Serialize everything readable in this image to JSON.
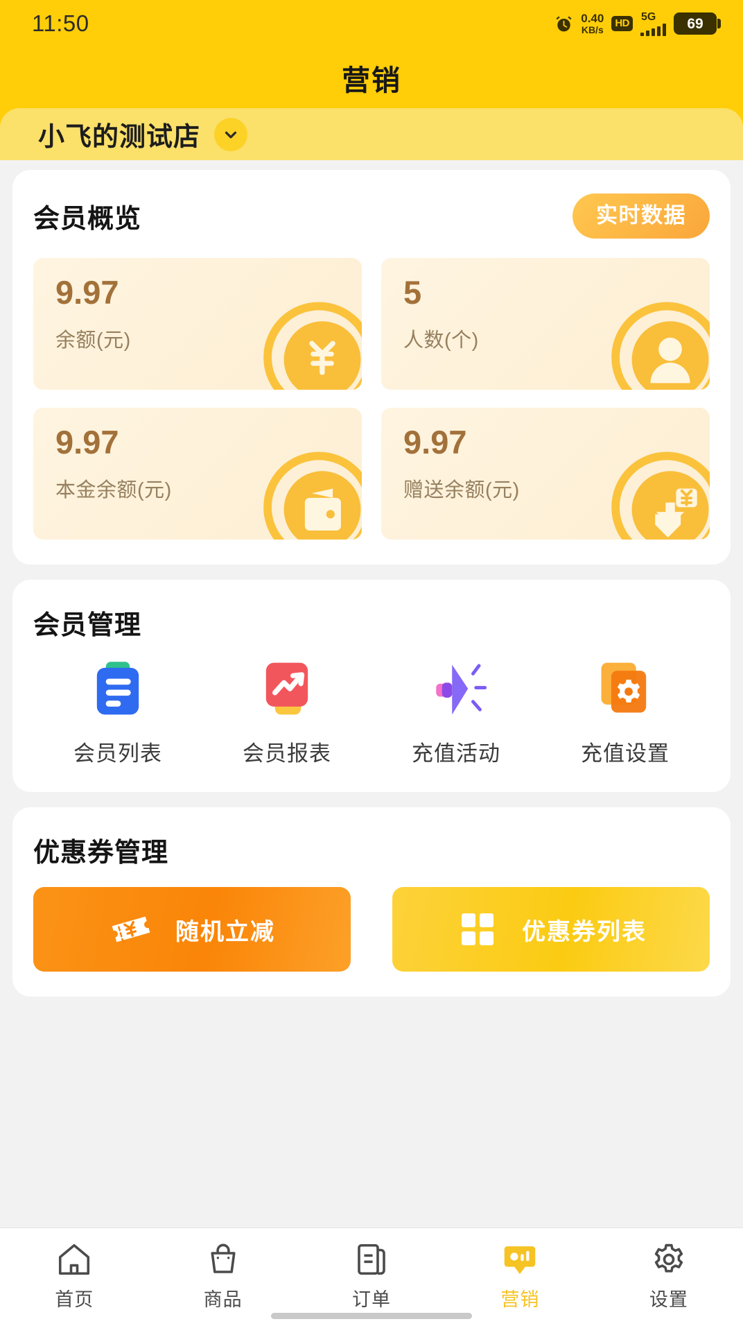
{
  "statusbar": {
    "time": "11:50",
    "alarm_icon": "alarm-clock-icon",
    "netspeed_value": "0.40",
    "netspeed_unit": "KB/s",
    "hd_badge": "HD",
    "network_type": "5G",
    "signal_icon": "signal-bars-icon",
    "battery_level": "69"
  },
  "header": {
    "title": "营销"
  },
  "store_selector": {
    "name": "小飞的测试店",
    "chevron_icon": "chevron-down-icon"
  },
  "overview": {
    "title": "会员概览",
    "realtime_button": "实时数据",
    "stats": [
      {
        "value": "9.97",
        "label": "余额(元)",
        "icon": "yen-coin-icon"
      },
      {
        "value": "5",
        "label": "人数(个)",
        "icon": "person-coin-icon"
      },
      {
        "value": "9.97",
        "label": "本金余额(元)",
        "icon": "wallet-coin-icon"
      },
      {
        "value": "9.97",
        "label": "赠送余额(元)",
        "icon": "gift-yen-coin-icon"
      }
    ]
  },
  "member_management": {
    "title": "会员管理",
    "items": [
      {
        "label": "会员列表",
        "icon": "clipboard-list-icon"
      },
      {
        "label": "会员报表",
        "icon": "trend-chart-icon"
      },
      {
        "label": "充值活动",
        "icon": "megaphone-icon"
      },
      {
        "label": "充值设置",
        "icon": "gear-layers-icon"
      }
    ]
  },
  "coupon_management": {
    "title": "优惠券管理",
    "buttons": [
      {
        "label": "随机立减",
        "icon": "ticket-yen-icon",
        "color": "#FA8508"
      },
      {
        "label": "优惠券列表",
        "icon": "grid-squares-icon",
        "color": "#FBCB12"
      }
    ]
  },
  "tabbar": {
    "items": [
      {
        "label": "首页",
        "icon": "home-icon",
        "active": false
      },
      {
        "label": "商品",
        "icon": "bag-icon",
        "active": false
      },
      {
        "label": "订单",
        "icon": "order-doc-icon",
        "active": false
      },
      {
        "label": "营销",
        "icon": "marketing-icon",
        "active": true
      },
      {
        "label": "设置",
        "icon": "gear-icon",
        "active": false
      }
    ]
  },
  "colors": {
    "brand_yellow": "#FFCE08",
    "store_band": "#FBE06A",
    "accent_orange": "#FAA63A",
    "stat_value": "#A2713A",
    "stat_bg": "#FEF4E0",
    "page_bg": "#f2f2f2",
    "active_tab": "#F6C324"
  }
}
